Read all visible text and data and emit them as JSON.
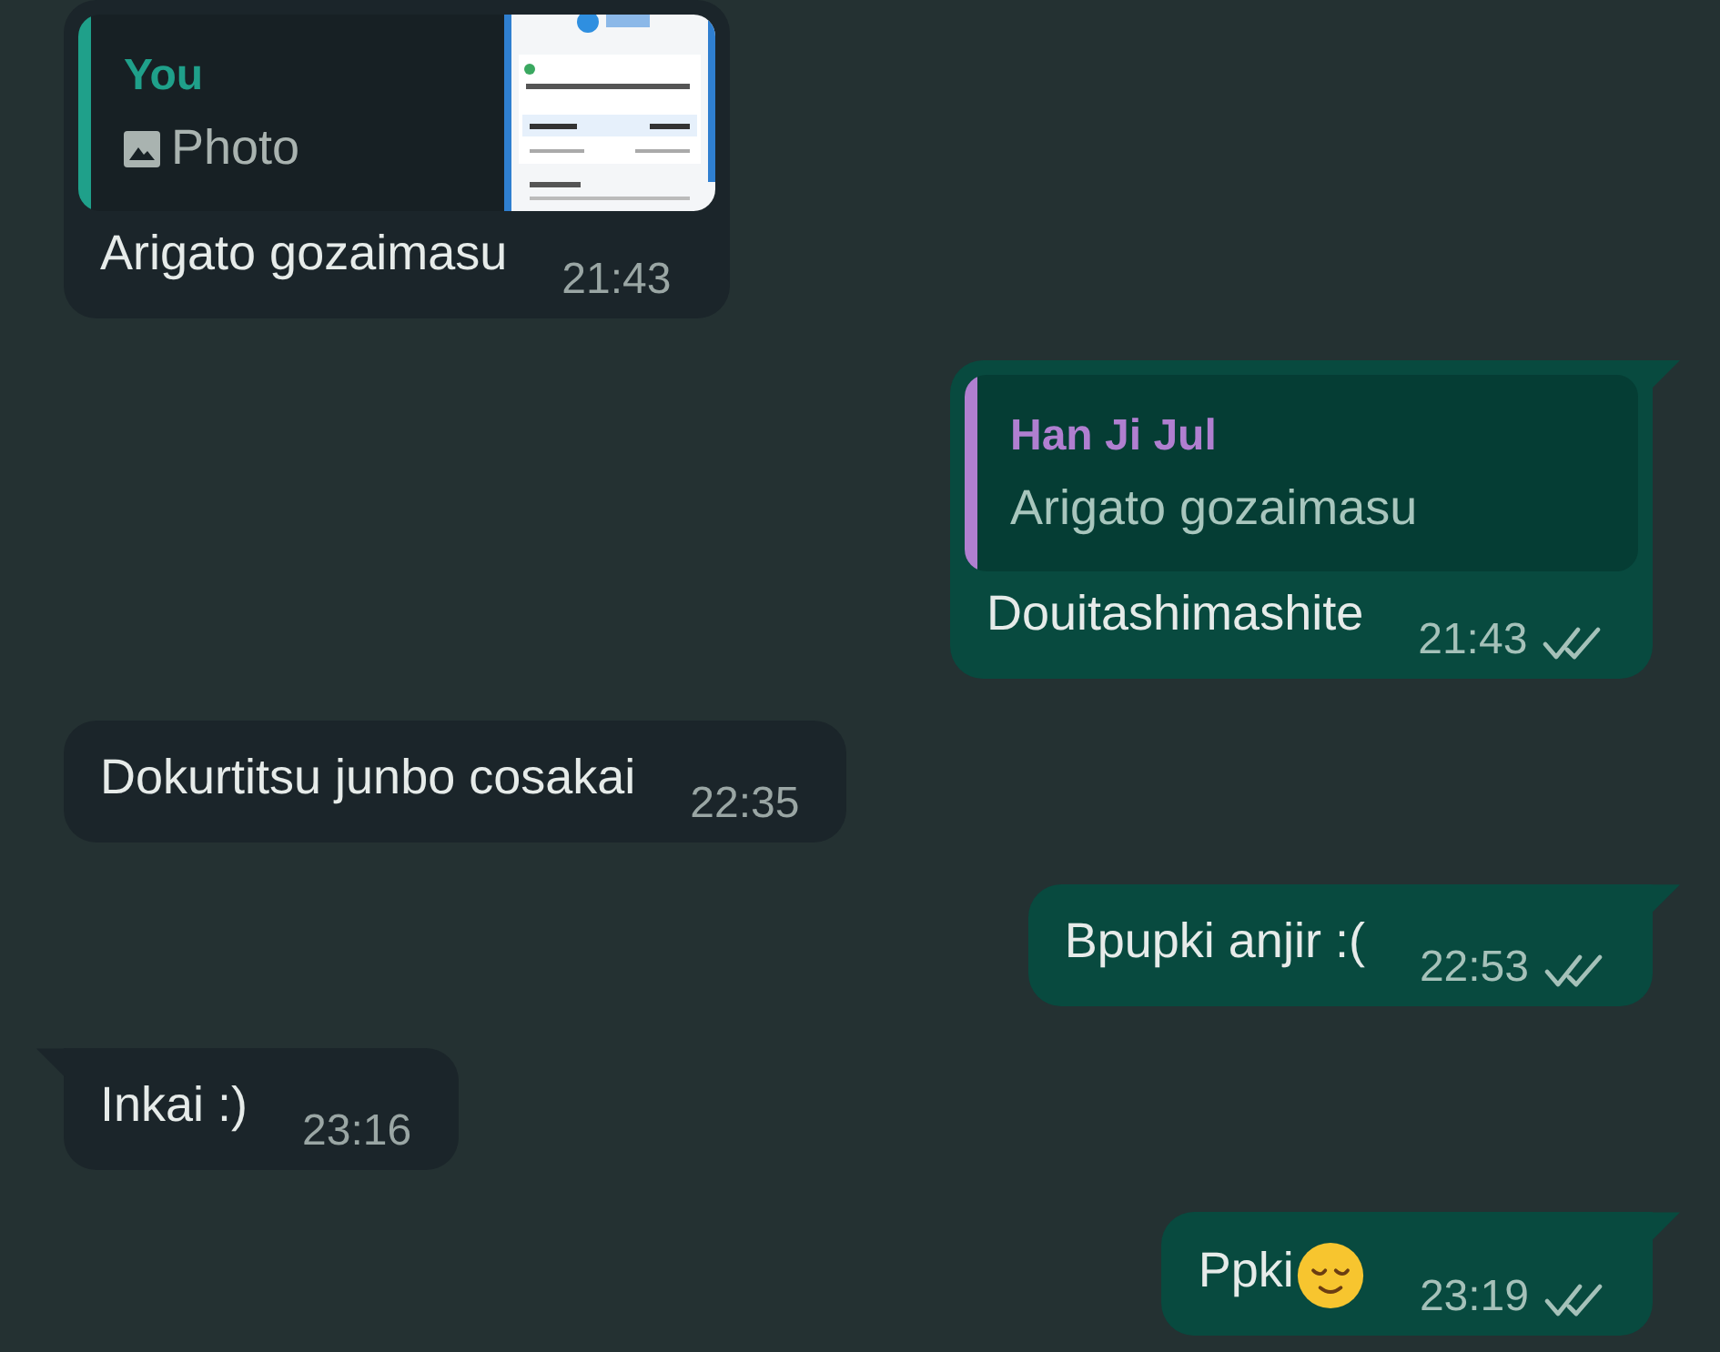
{
  "messages": [
    {
      "kind": "incoming",
      "tail": false,
      "quote": {
        "author": "You",
        "color": "#1fa08a",
        "text": "Photo"
      },
      "text": "Arigato gozaimasu",
      "time": "21:43"
    },
    {
      "kind": "outgoing",
      "tail": true,
      "quote": {
        "author": "Han Ji Jul",
        "color": "#b07fd0",
        "kind": "text",
        "text": "Arigato gozaimasu"
      },
      "text": "Douitashimashite",
      "time": "21:43",
      "delivered": true
    },
    {
      "kind": "incoming",
      "tail": false,
      "text": "Dokurtitsu junbo cosakai",
      "time": "22:35"
    },
    {
      "kind": "outgoing",
      "tail": true,
      "text": "Bpupki anjir :(",
      "time": "22:53",
      "delivered": true
    },
    {
      "kind": "incoming",
      "tail": true,
      "text": "Inkai :)",
      "time": "23:16"
    },
    {
      "kind": "outgoing",
      "tail": true,
      "text": "Ppki",
      "emoji": true,
      "time": "23:19",
      "delivered": true
    }
  ]
}
